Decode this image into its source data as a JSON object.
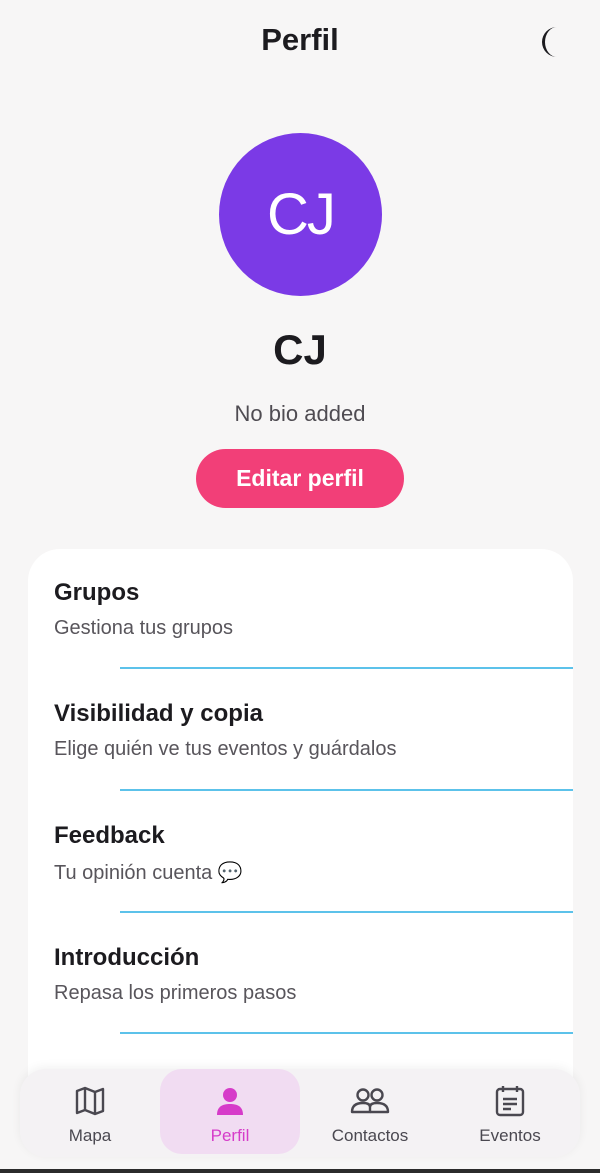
{
  "header": {
    "title": "Perfil",
    "theme_icon": "moon-icon"
  },
  "profile": {
    "initials": "CJ",
    "avatar_color": "#7b3ae6",
    "name": "CJ",
    "bio": "No bio added",
    "edit_label": "Editar perfil",
    "accent_color": "#f23f78"
  },
  "menu": {
    "items": [
      {
        "title": "Grupos",
        "subtitle": "Gestiona tus grupos"
      },
      {
        "title": "Visibilidad y copia",
        "subtitle": "Elige quién ve tus eventos y guárdalos"
      },
      {
        "title": "Feedback",
        "subtitle": "Tu opinión cuenta 💬"
      },
      {
        "title": "Introducción",
        "subtitle": "Repasa los primeros pasos"
      }
    ],
    "divider_color": "#5cc2ea"
  },
  "nav": {
    "items": [
      {
        "label": "Mapa",
        "icon": "map-icon"
      },
      {
        "label": "Perfil",
        "icon": "person-icon",
        "active": true
      },
      {
        "label": "Contactos",
        "icon": "people-icon"
      },
      {
        "label": "Eventos",
        "icon": "calendar-icon"
      }
    ],
    "active_color": "#d63cc9"
  }
}
